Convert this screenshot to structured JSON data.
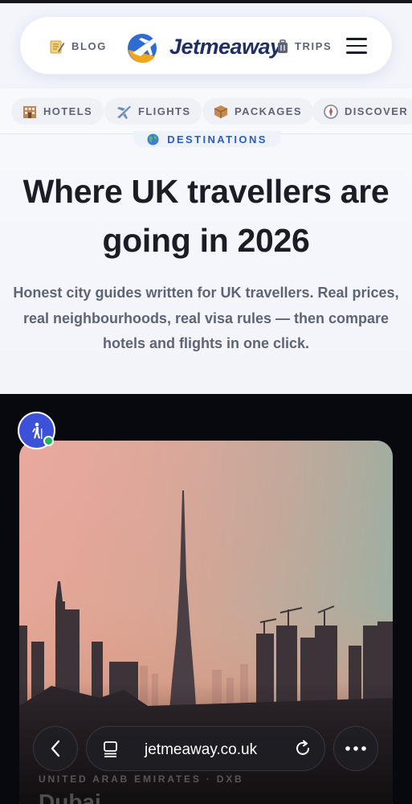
{
  "header": {
    "blog_label": "BLOG",
    "brand_name": "Jetmeaway",
    "trips_label": "TRIPS"
  },
  "categories": [
    {
      "label": "HOTELS",
      "icon": "hotel-icon"
    },
    {
      "label": "FLIGHTS",
      "icon": "airplane-icon"
    },
    {
      "label": "PACKAGES",
      "icon": "package-icon"
    },
    {
      "label": "DISCOVER",
      "icon": "compass-icon"
    }
  ],
  "hero": {
    "eyebrow": "DESTINATIONS",
    "title": "Where UK travellers are going in 2026",
    "subtitle": "Honest city guides written for UK travellers. Real prices, real neighbourhoods, real visa rules — then compare hotels and flights in one click."
  },
  "card": {
    "country": "UNITED ARAB EMIRATES · DXB",
    "city": "Dubai"
  },
  "browser": {
    "url": "jetmeaway.co.uk"
  },
  "colors": {
    "accent_blue": "#2e5bc4",
    "avatar_blue": "#3c50d8",
    "online_green": "#22b45e",
    "dark_bg": "#07090e"
  }
}
